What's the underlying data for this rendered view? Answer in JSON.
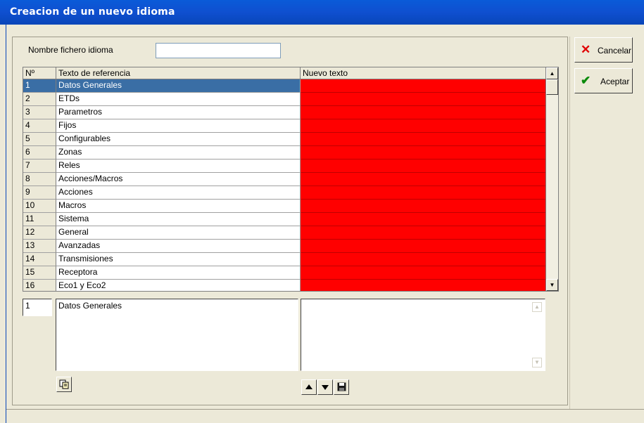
{
  "window": {
    "title": "Creacion de un nuevo idioma"
  },
  "form": {
    "filename_label": "Nombre fichero idioma",
    "filename_value": ""
  },
  "grid": {
    "headers": {
      "num": "Nº",
      "reference": "Texto de referencia",
      "new_text": "Nuevo texto"
    },
    "rows": [
      {
        "num": "1",
        "reference": "Datos Generales",
        "new_text": ""
      },
      {
        "num": "2",
        "reference": "ETDs",
        "new_text": ""
      },
      {
        "num": "3",
        "reference": "Parametros",
        "new_text": ""
      },
      {
        "num": "4",
        "reference": "Fijos",
        "new_text": ""
      },
      {
        "num": "5",
        "reference": "Configurables",
        "new_text": ""
      },
      {
        "num": "6",
        "reference": "Zonas",
        "new_text": ""
      },
      {
        "num": "7",
        "reference": "Reles",
        "new_text": ""
      },
      {
        "num": "8",
        "reference": "Acciones/Macros",
        "new_text": ""
      },
      {
        "num": "9",
        "reference": "Acciones",
        "new_text": ""
      },
      {
        "num": "10",
        "reference": "Macros",
        "new_text": ""
      },
      {
        "num": "11",
        "reference": "Sistema",
        "new_text": ""
      },
      {
        "num": "12",
        "reference": "General",
        "new_text": ""
      },
      {
        "num": "13",
        "reference": "Avanzadas",
        "new_text": ""
      },
      {
        "num": "14",
        "reference": "Transmisiones",
        "new_text": ""
      },
      {
        "num": "15",
        "reference": "Receptora",
        "new_text": ""
      },
      {
        "num": "16",
        "reference": "Eco1 y Eco2",
        "new_text": ""
      }
    ],
    "selected_index": 0,
    "highlight_color": "#3a6ea5",
    "empty_cell_color": "#ff0000"
  },
  "detail": {
    "num": "1",
    "reference": "Datos Generales",
    "new_text": ""
  },
  "buttons": {
    "cancel_label": "Cancelar",
    "accept_label": "Aceptar"
  },
  "icons": {
    "cancel": "close-x-icon",
    "accept": "checkmark-icon",
    "copy": "copy-icon",
    "up": "arrow-up-icon",
    "down": "arrow-down-icon",
    "save": "floppy-disk-icon"
  }
}
